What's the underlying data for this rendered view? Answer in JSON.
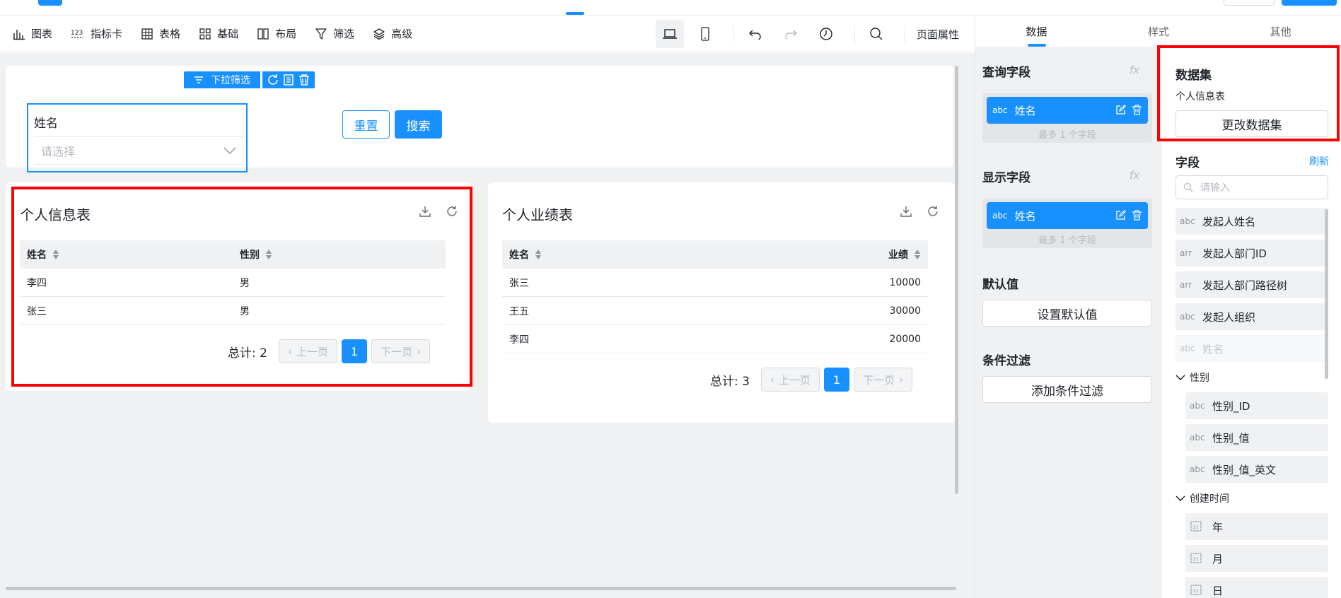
{
  "toolbar": {
    "items": [
      {
        "label": "图表",
        "icon": "bar-chart-icon"
      },
      {
        "label": "指标卡",
        "icon": "metric-icon"
      },
      {
        "label": "表格",
        "icon": "table-icon"
      },
      {
        "label": "基础",
        "icon": "grid-icon"
      },
      {
        "label": "布局",
        "icon": "layout-icon"
      },
      {
        "label": "筛选",
        "icon": "filter-icon"
      },
      {
        "label": "高级",
        "icon": "layers-icon"
      }
    ],
    "page_props": "页面属性"
  },
  "filter": {
    "tag": "下拉筛选",
    "label": "姓名",
    "placeholder": "请选择",
    "reset": "重置",
    "search": "搜索"
  },
  "table1": {
    "title": "个人信息表",
    "columns": [
      "姓名",
      "性别"
    ],
    "rows": [
      [
        "李四",
        "男"
      ],
      [
        "张三",
        "男"
      ]
    ],
    "total": "总计: 2",
    "prev": "上一页",
    "page": "1",
    "next": "下一页"
  },
  "table2": {
    "title": "个人业绩表",
    "columns": [
      "姓名",
      "业绩"
    ],
    "rows": [
      [
        "张三",
        "10000"
      ],
      [
        "王五",
        "30000"
      ],
      [
        "李四",
        "20000"
      ]
    ],
    "total": "总计: 3",
    "prev": "上一页",
    "page": "1",
    "next": "下一页"
  },
  "panel": {
    "tabs": [
      "数据",
      "样式",
      "其他"
    ],
    "query": {
      "title": "查询字段",
      "field": "姓名",
      "type": "abc",
      "note": "最多 1 个字段"
    },
    "display": {
      "title": "显示字段",
      "field": "姓名",
      "type": "abc",
      "note": "最多 1 个字段"
    },
    "fx": "fx",
    "default": {
      "title": "默认值",
      "button": "设置默认值"
    },
    "condition": {
      "title": "条件过滤",
      "button": "添加条件过滤"
    },
    "dataset": {
      "title": "数据集",
      "name": "个人信息表",
      "button": "更改数据集"
    },
    "fields": {
      "title": "字段",
      "refresh": "刷新",
      "placeholder": "请输入",
      "items": [
        {
          "type": "abc",
          "name": "发起人姓名"
        },
        {
          "type": "arr",
          "name": "发起人部门ID"
        },
        {
          "type": "arr",
          "name": "发起人部门路径树"
        },
        {
          "type": "abc",
          "name": "发起人组织"
        },
        {
          "type": "abc",
          "name": "姓名"
        }
      ],
      "group1": {
        "name": "性别",
        "items": [
          {
            "type": "abc",
            "name": "性别_ID"
          },
          {
            "type": "abc",
            "name": "性别_值"
          },
          {
            "type": "abc",
            "name": "性别_值_英文"
          }
        ]
      },
      "group2": {
        "name": "创建时间",
        "items": [
          {
            "name": "年"
          },
          {
            "name": "月"
          },
          {
            "name": "日"
          }
        ]
      }
    }
  }
}
